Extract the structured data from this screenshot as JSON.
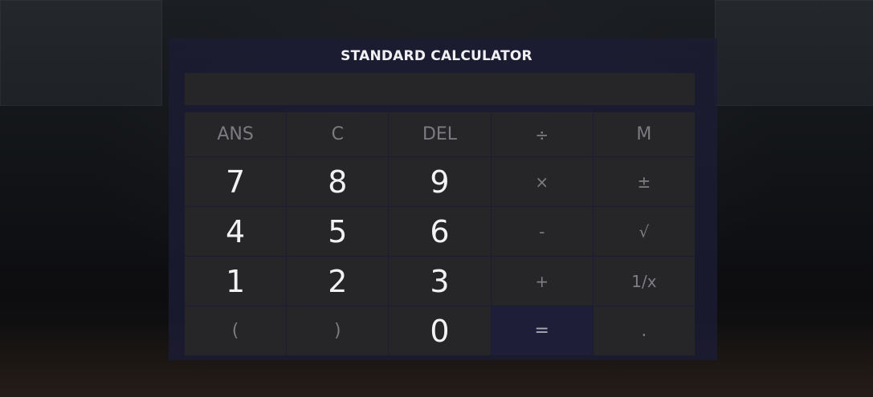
{
  "calculator": {
    "title": "STANDARD CALCULATOR",
    "display_value": ""
  },
  "keys": {
    "ans": "ANS",
    "clear": "C",
    "del": "DEL",
    "divide": "÷",
    "memory": "M",
    "seven": "7",
    "eight": "8",
    "nine": "9",
    "multiply": "×",
    "plus_minus": "±",
    "four": "4",
    "five": "5",
    "six": "6",
    "minus": "-",
    "sqrt": "√",
    "one": "1",
    "two": "2",
    "three": "3",
    "plus": "+",
    "reciprocal": "1/x",
    "open_paren": "(",
    "close_paren": ")",
    "zero": "0",
    "equals": "=",
    "decimal": "."
  },
  "colors": {
    "panel": "#1c1c34",
    "key": "#262629",
    "equals_key": "#1e1e38",
    "digit_text": "#f2f2f2",
    "function_text": "#7b7b80"
  }
}
